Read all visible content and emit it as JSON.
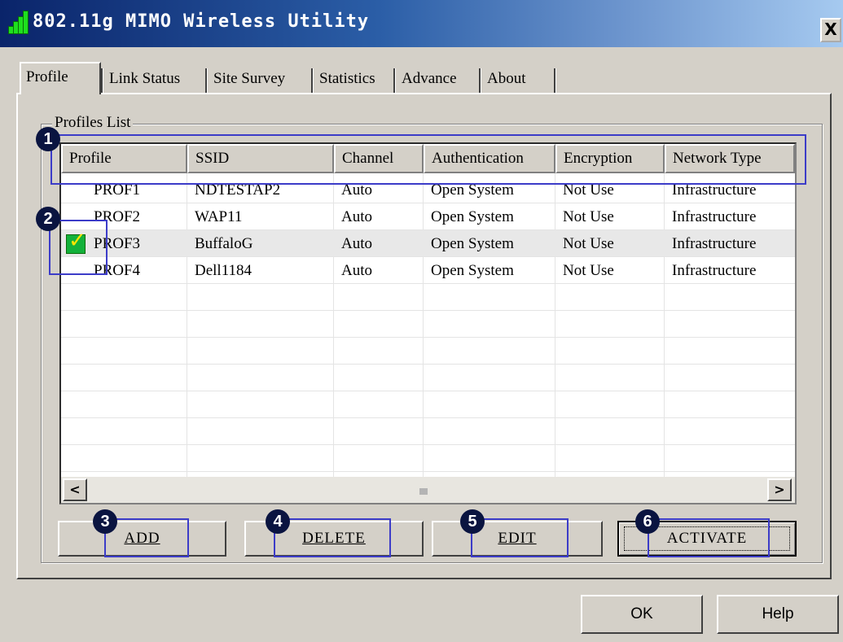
{
  "window": {
    "title": "802.11g MIMO Wireless Utility",
    "close_label": "X"
  },
  "tabs": [
    {
      "label": "Profile"
    },
    {
      "label": "Link Status"
    },
    {
      "label": "Site Survey"
    },
    {
      "label": "Statistics"
    },
    {
      "label": "Advance"
    },
    {
      "label": "About"
    }
  ],
  "profiles_group": {
    "label": "Profiles List"
  },
  "table": {
    "columns": [
      "Profile",
      "SSID",
      "Channel",
      "Authentication",
      "Encryption",
      "Network Type"
    ],
    "rows": [
      {
        "profile": "PROF1",
        "ssid": "NDTESTAP2",
        "channel": "Auto",
        "authentication": "Open System",
        "encryption": "Not Use",
        "network_type": "Infrastructure",
        "active": false
      },
      {
        "profile": "PROF2",
        "ssid": "WAP11",
        "channel": "Auto",
        "authentication": "Open System",
        "encryption": "Not Use",
        "network_type": "Infrastructure",
        "active": false
      },
      {
        "profile": "PROF3",
        "ssid": "BuffaloG",
        "channel": "Auto",
        "authentication": "Open System",
        "encryption": "Not Use",
        "network_type": "Infrastructure",
        "active": true
      },
      {
        "profile": "PROF4",
        "ssid": "Dell1184",
        "channel": "Auto",
        "authentication": "Open System",
        "encryption": "Not Use",
        "network_type": "Infrastructure",
        "active": false
      }
    ]
  },
  "scrollbar": {
    "left_icon": "<",
    "right_icon": ">"
  },
  "buttons": {
    "add": "ADD",
    "delete": "DELETE",
    "edit": "EDIT",
    "activate": "ACTIVATE",
    "ok": "OK",
    "help": "Help"
  },
  "annotations": [
    "1",
    "2",
    "3",
    "4",
    "5",
    "6"
  ],
  "icons": {
    "app": "signal-bars-icon",
    "active_profile": "checkmark-icon"
  }
}
